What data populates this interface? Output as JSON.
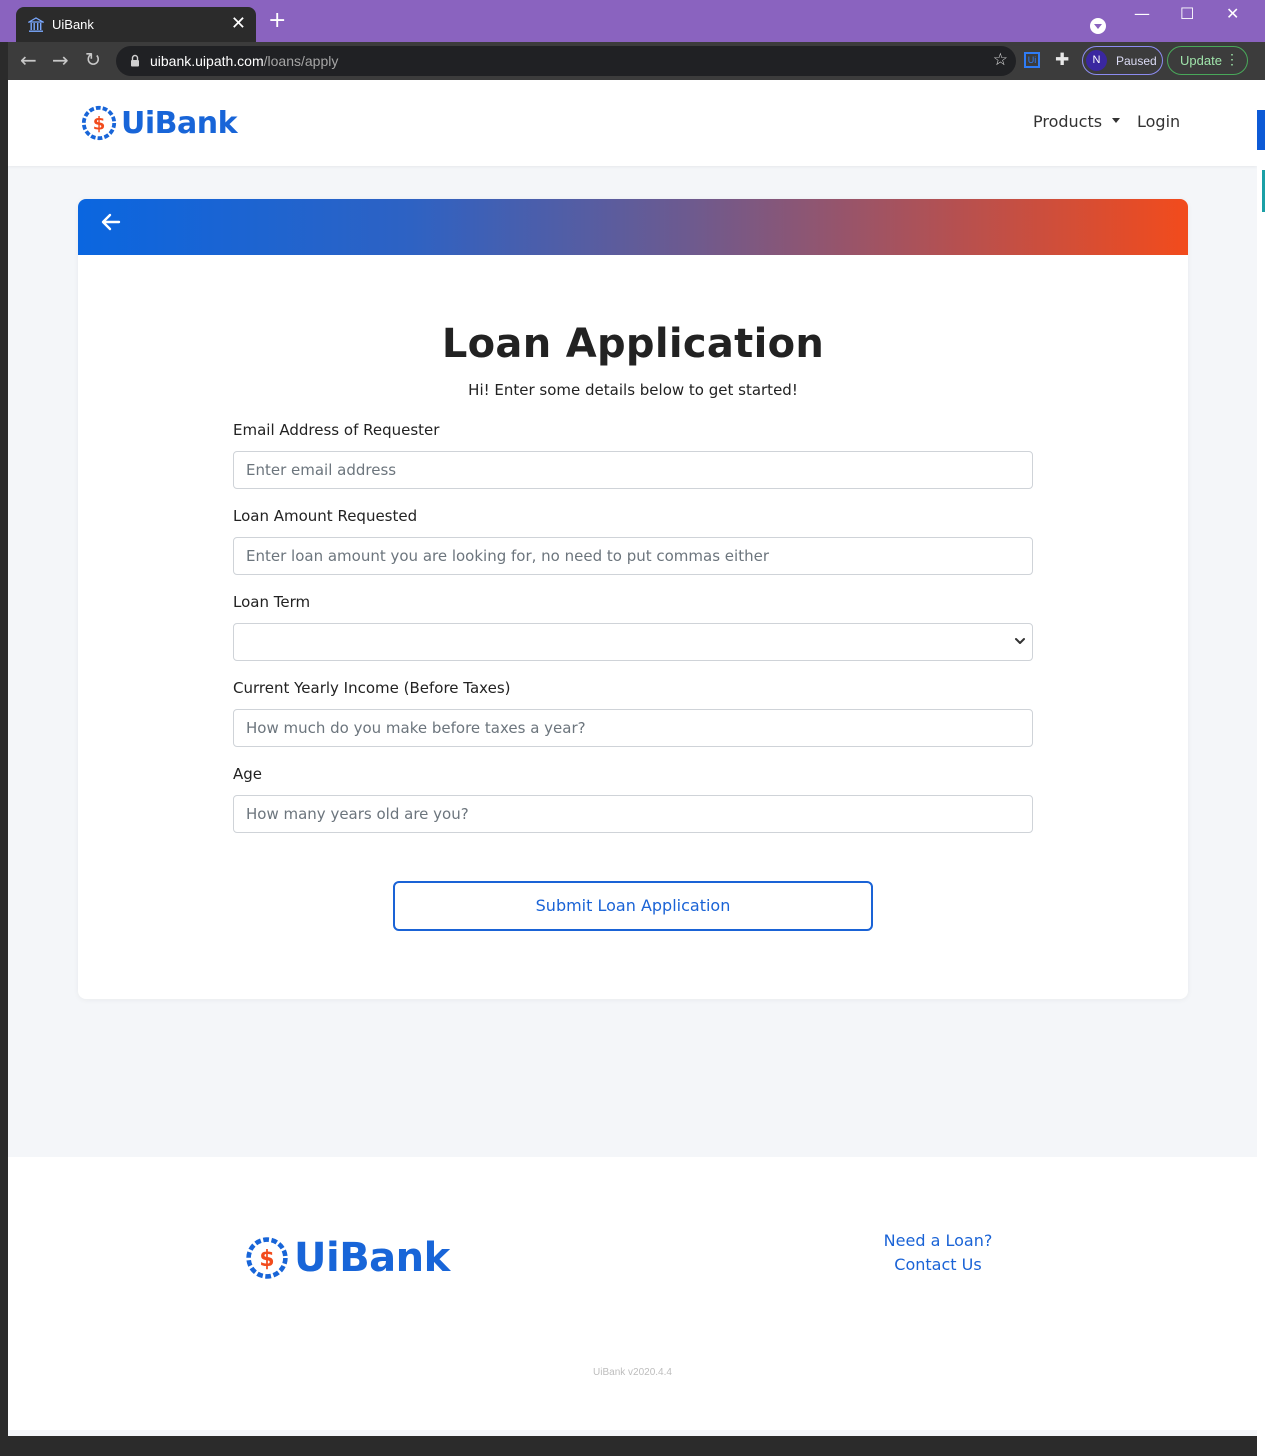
{
  "browser": {
    "tab_title": "UiBank",
    "tab_close": "✕",
    "new_tab": "+",
    "url_host": "uibank.uipath.com",
    "url_path": "/loans/apply",
    "extension_ui": "Ui",
    "profile_initial": "N",
    "profile_status": "Paused",
    "update_label": "Update",
    "window_minimize": "—",
    "window_maximize": "☐",
    "window_close": "✕"
  },
  "header": {
    "logo_text": "UiBank",
    "nav": {
      "products": "Products",
      "login": "Login"
    }
  },
  "form": {
    "title": "Loan Application",
    "subtitle": "Hi! Enter some details below to get started!",
    "fields": [
      {
        "label": "Email Address of Requester",
        "placeholder": "Enter email address",
        "value": ""
      },
      {
        "label": "Loan Amount Requested",
        "placeholder": "Enter loan amount you are looking for, no need to put commas either",
        "value": ""
      },
      {
        "label": "Loan Term",
        "selected": ""
      },
      {
        "label": "Current Yearly Income (Before Taxes)",
        "placeholder": "How much do you make before taxes a year?",
        "value": ""
      },
      {
        "label": "Age",
        "placeholder": "How many years old are you?",
        "value": ""
      }
    ],
    "submit_label": "Submit Loan Application"
  },
  "footer": {
    "logo_text": "UiBank",
    "links": [
      "Need a Loan?",
      "Contact Us"
    ],
    "version": "UiBank v2020.4.4"
  },
  "colors": {
    "brand_blue": "#1865d8",
    "brand_orange": "#f24b1c",
    "chrome_purple": "#8a63bf",
    "page_bg": "#f4f6f9"
  }
}
